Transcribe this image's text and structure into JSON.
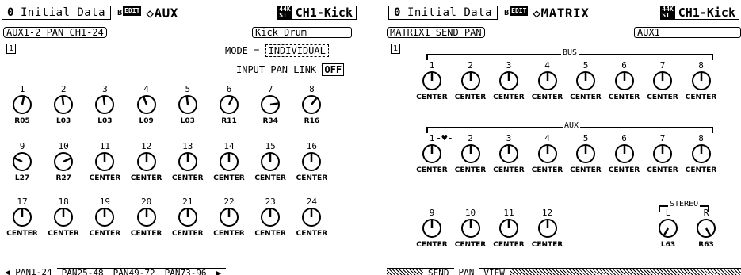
{
  "left": {
    "header": {
      "scene_number": "0",
      "scene_name": "Initial Data",
      "flag_b": "B",
      "flag_edit": "EDIT",
      "function": "◇AUX",
      "fs_top": "44K",
      "fs_bottom": "ST",
      "channel": "CH1-Kick"
    },
    "sub_left": "AUX1-2 PAN CH1-24",
    "sub_right": "Kick Drum",
    "page_box": "1",
    "mode_label": "MODE =",
    "mode_value": "INDIVIDUAL",
    "link_label": "INPUT PAN LINK",
    "link_value": "OFF",
    "knobs": [
      {
        "num": "1",
        "val": "R05",
        "pan": 5
      },
      {
        "num": "2",
        "val": "L03",
        "pan": -3
      },
      {
        "num": "3",
        "val": "L03",
        "pan": -3
      },
      {
        "num": "4",
        "val": "L09",
        "pan": -9
      },
      {
        "num": "5",
        "val": "L03",
        "pan": -3
      },
      {
        "num": "6",
        "val": "R11",
        "pan": 11
      },
      {
        "num": "7",
        "val": "R34",
        "pan": 34
      },
      {
        "num": "8",
        "val": "R16",
        "pan": 16
      },
      {
        "num": "9",
        "val": "L27",
        "pan": -27
      },
      {
        "num": "10",
        "val": "R27",
        "pan": 27
      },
      {
        "num": "11",
        "val": "CENTER",
        "pan": 0
      },
      {
        "num": "12",
        "val": "CENTER",
        "pan": 0
      },
      {
        "num": "13",
        "val": "CENTER",
        "pan": 0
      },
      {
        "num": "14",
        "val": "CENTER",
        "pan": 0
      },
      {
        "num": "15",
        "val": "CENTER",
        "pan": 0
      },
      {
        "num": "16",
        "val": "CENTER",
        "pan": 0
      },
      {
        "num": "17",
        "val": "CENTER",
        "pan": 0
      },
      {
        "num": "18",
        "val": "CENTER",
        "pan": 0
      },
      {
        "num": "19",
        "val": "CENTER",
        "pan": 0
      },
      {
        "num": "20",
        "val": "CENTER",
        "pan": 0
      },
      {
        "num": "21",
        "val": "CENTER",
        "pan": 0
      },
      {
        "num": "22",
        "val": "CENTER",
        "pan": 0
      },
      {
        "num": "23",
        "val": "CENTER",
        "pan": 0
      },
      {
        "num": "24",
        "val": "CENTER",
        "pan": 0
      }
    ],
    "tabs": [
      "◀ PAN1-24",
      "PAN25-48",
      "PAN49-72",
      "PAN73-96",
      "▶"
    ]
  },
  "right": {
    "header": {
      "scene_number": "0",
      "scene_name": "Initial Data",
      "flag_b": "B",
      "flag_edit": "EDIT",
      "function": "◇MATRIX",
      "fs_top": "44K",
      "fs_bottom": "ST",
      "channel": "CH1-Kick"
    },
    "sub_left": "MATRIX1 SEND PAN",
    "sub_right": "AUX1",
    "page_box": "1",
    "bus_label": "BUS",
    "aux_label": "AUX",
    "stereo_label": "STEREO",
    "bus_knobs": [
      {
        "num": "1",
        "val": "CENTER",
        "pan": 0
      },
      {
        "num": "2",
        "val": "CENTER",
        "pan": 0
      },
      {
        "num": "3",
        "val": "CENTER",
        "pan": 0
      },
      {
        "num": "4",
        "val": "CENTER",
        "pan": 0
      },
      {
        "num": "5",
        "val": "CENTER",
        "pan": 0
      },
      {
        "num": "6",
        "val": "CENTER",
        "pan": 0
      },
      {
        "num": "7",
        "val": "CENTER",
        "pan": 0
      },
      {
        "num": "8",
        "val": "CENTER",
        "pan": 0
      }
    ],
    "aux_knobs": [
      {
        "num": "1",
        "val": "CENTER",
        "pan": 0
      },
      {
        "num": "2",
        "val": "CENTER",
        "pan": 0
      },
      {
        "num": "3",
        "val": "CENTER",
        "pan": 0
      },
      {
        "num": "4",
        "val": "CENTER",
        "pan": 0
      },
      {
        "num": "5",
        "val": "CENTER",
        "pan": 0
      },
      {
        "num": "6",
        "val": "CENTER",
        "pan": 0
      },
      {
        "num": "7",
        "val": "CENTER",
        "pan": 0
      },
      {
        "num": "8",
        "val": "CENTER",
        "pan": 0
      }
    ],
    "aux_link_symbol": "-♥-",
    "row3_knobs": [
      {
        "num": "9",
        "val": "CENTER",
        "pan": 0
      },
      {
        "num": "10",
        "val": "CENTER",
        "pan": 0
      },
      {
        "num": "11",
        "val": "CENTER",
        "pan": 0
      },
      {
        "num": "12",
        "val": "CENTER",
        "pan": 0
      }
    ],
    "stereo_knobs": [
      {
        "num": "L",
        "val": "L63",
        "pan": -63
      },
      {
        "num": "R",
        "val": "R63",
        "pan": 63
      }
    ],
    "tabs": [
      "SEND",
      "PAN",
      "VIEW"
    ]
  }
}
